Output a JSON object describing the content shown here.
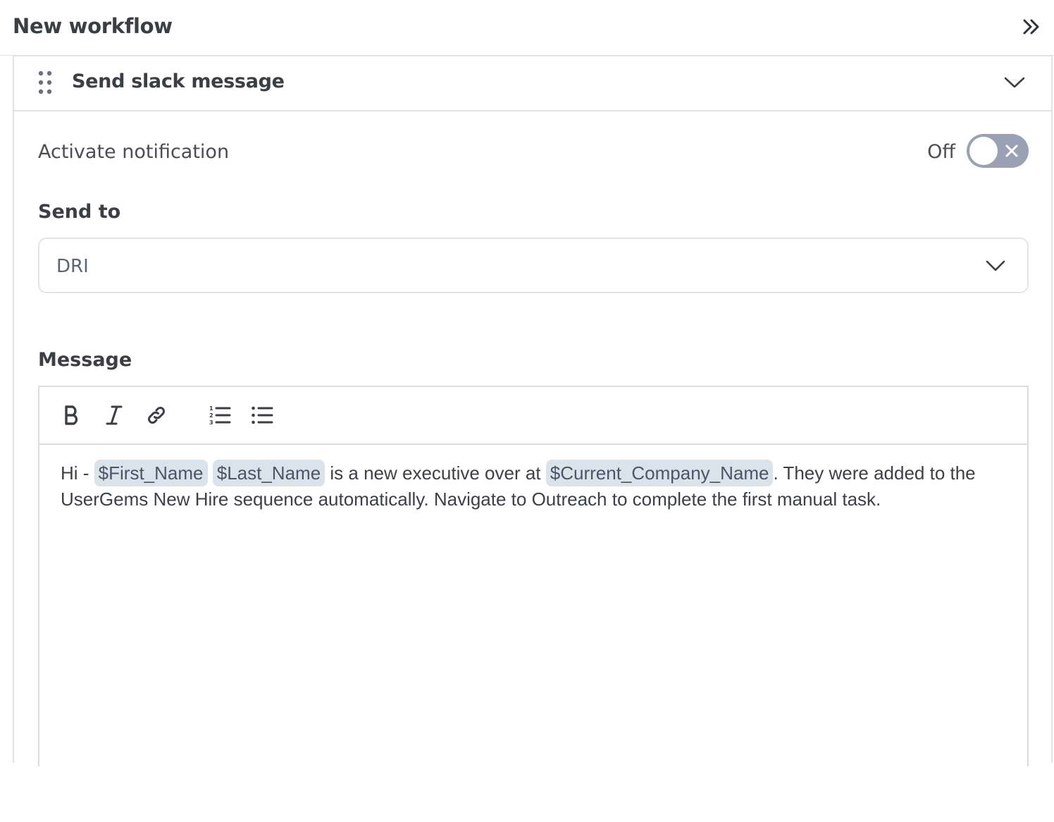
{
  "header": {
    "title": "New workflow",
    "collapse_icon": "double-chevron-right-icon"
  },
  "card": {
    "title": "Send slack message",
    "drag_icon": "drag-handle-icon",
    "chevron_icon": "chevron-down-icon"
  },
  "notification": {
    "label": "Activate notification",
    "state_label": "Off",
    "enabled": false
  },
  "send_to": {
    "label": "Send to",
    "value": "DRI"
  },
  "message": {
    "label": "Message",
    "toolbar": [
      "bold-icon",
      "italic-icon",
      "link-icon",
      "ordered-list-icon",
      "bullet-list-icon"
    ],
    "text_1": "Hi - ",
    "token_first": "$First_Name",
    "token_last": "$Last_Name",
    "text_2": " is a new executive over at ",
    "token_company": "$Current_Company_Name",
    "text_3": ". They were added to the UserGems New Hire sequence automatically. Navigate to Outreach to complete the first manual task."
  },
  "colors": {
    "border": "#dfe3e8",
    "toggle_off": "#9aa1b4",
    "token_bg": "#dbe3ea",
    "text": "#3b3e44"
  }
}
